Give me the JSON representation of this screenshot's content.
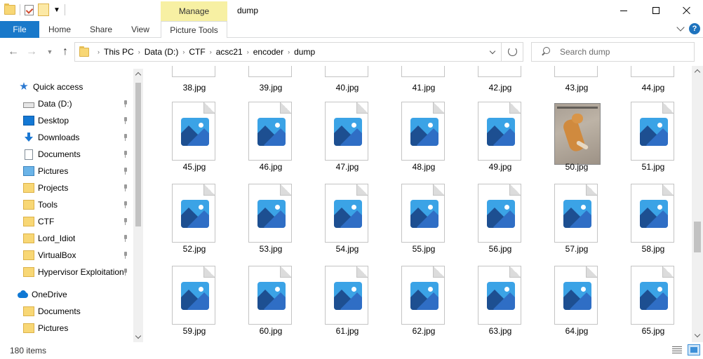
{
  "window": {
    "title": "dump",
    "contextual_tab_group": "Manage"
  },
  "ribbon": {
    "tabs": [
      {
        "label": "File"
      },
      {
        "label": "Home"
      },
      {
        "label": "Share"
      },
      {
        "label": "View"
      },
      {
        "label": "Picture Tools"
      }
    ],
    "help_label": "?"
  },
  "address": {
    "crumbs": [
      "This PC",
      "Data (D:)",
      "CTF",
      "acsc21",
      "encoder",
      "dump"
    ]
  },
  "search": {
    "placeholder": "Search dump"
  },
  "sidebar": {
    "quick_access": "Quick access",
    "items": [
      {
        "label": "Data (D:)",
        "icon": "drive-icon",
        "pinned": true
      },
      {
        "label": "Desktop",
        "icon": "desktop-icon",
        "pinned": true
      },
      {
        "label": "Downloads",
        "icon": "downloads-icon",
        "pinned": true
      },
      {
        "label": "Documents",
        "icon": "documents-icon",
        "pinned": true
      },
      {
        "label": "Pictures",
        "icon": "pictures-icon",
        "pinned": true
      },
      {
        "label": "Projects",
        "icon": "folder-icon",
        "pinned": true
      },
      {
        "label": "Tools",
        "icon": "folder-icon",
        "pinned": true
      },
      {
        "label": "CTF",
        "icon": "folder-icon",
        "pinned": true
      },
      {
        "label": "Lord_Idiot",
        "icon": "folder-icon",
        "pinned": true
      },
      {
        "label": "VirtualBox",
        "icon": "folder-icon",
        "pinned": true
      },
      {
        "label": "Hypervisor Exploitation",
        "icon": "folder-icon",
        "pinned": true
      }
    ],
    "onedrive": "OneDrive",
    "onedrive_items": [
      {
        "label": "Documents",
        "icon": "folder-icon"
      },
      {
        "label": "Pictures",
        "icon": "folder-icon"
      }
    ]
  },
  "files": {
    "partial_row": [
      "38.jpg",
      "39.jpg",
      "40.jpg",
      "41.jpg",
      "42.jpg",
      "43.jpg",
      "44.jpg"
    ],
    "rows": [
      [
        "45.jpg",
        "46.jpg",
        "47.jpg",
        "48.jpg",
        "49.jpg",
        "50.jpg",
        "51.jpg"
      ],
      [
        "52.jpg",
        "53.jpg",
        "54.jpg",
        "55.jpg",
        "56.jpg",
        "57.jpg",
        "58.jpg"
      ],
      [
        "59.jpg",
        "60.jpg",
        "61.jpg",
        "62.jpg",
        "63.jpg",
        "64.jpg",
        "65.jpg"
      ]
    ],
    "photo_thumbnail": "50.jpg"
  },
  "status": {
    "item_count": "180 items"
  },
  "colors": {
    "file_tab": "#1979ca",
    "manage_tab": "#f7f0a3",
    "folder": "#f8d775",
    "image_icon": "#3ba3e6"
  }
}
